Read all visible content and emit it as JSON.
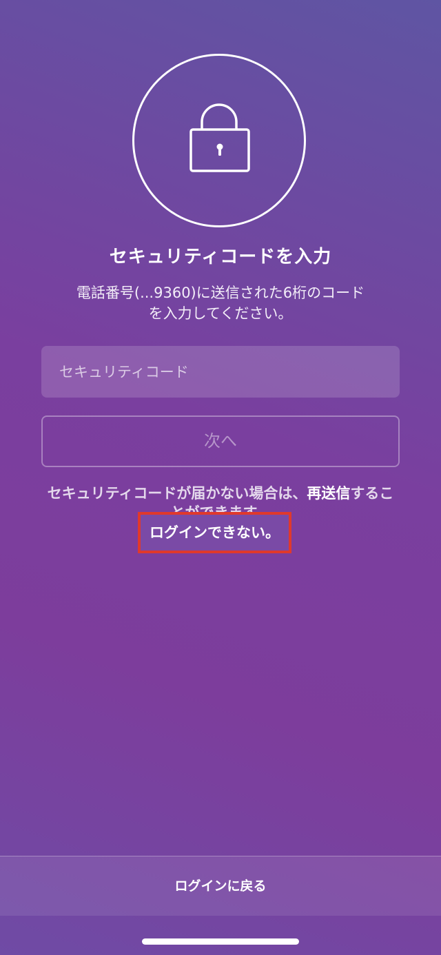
{
  "header": {
    "lock_icon": "padlock-icon",
    "title": "セキュリティコードを入力",
    "subtitle": "電話番号(...9360)に送信された6桁のコードを入力してください。"
  },
  "form": {
    "code_placeholder": "セキュリティコード",
    "code_value": "",
    "next_label": "次へ"
  },
  "help": {
    "resend_prefix": "セキュリティコードが届かない場合は、",
    "resend_link": "再送信",
    "resend_suffix": "することができます。",
    "cant_login": "ログインできない。"
  },
  "footer": {
    "back_to_login": "ログインに戻る"
  },
  "colors": {
    "highlight_box": "#e0392c",
    "background_start": "#5f55a3",
    "background_mid": "#7a3f9f"
  }
}
